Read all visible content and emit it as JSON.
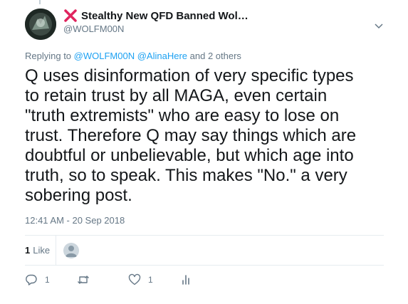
{
  "author": {
    "display_name": "Stealthy New QFD Banned Wol…",
    "handle": "@WOLFM00N"
  },
  "reply": {
    "prefix": "Replying to",
    "mention1": "@WOLFM00N",
    "mention2": "@AlinaHere",
    "suffix": "and 2 others"
  },
  "tweet": {
    "text": "Q uses disinformation of very specific types\nto retain trust by all MAGA, even certain\n\"truth extremists\" who are easy to lose on\ntrust. Therefore Q may say things which are\ndoubtful or unbelievable, but which age into\ntruth, so to speak. This makes \"No.\" a very\nsobering post.",
    "timestamp": "12:41 AM - 20 Sep 2018"
  },
  "stats": {
    "like_count": "1",
    "like_label": "Like"
  },
  "actions": {
    "reply_count": "1",
    "retweet_count": "",
    "like_count": "1"
  },
  "colors": {
    "accent": "#1da1f2",
    "muted": "#657786",
    "x_red": "#e0245e"
  },
  "icons": [
    "cross-mark-icon",
    "chevron-down-icon",
    "reply-icon",
    "retweet-icon",
    "heart-icon",
    "analytics-icon"
  ]
}
